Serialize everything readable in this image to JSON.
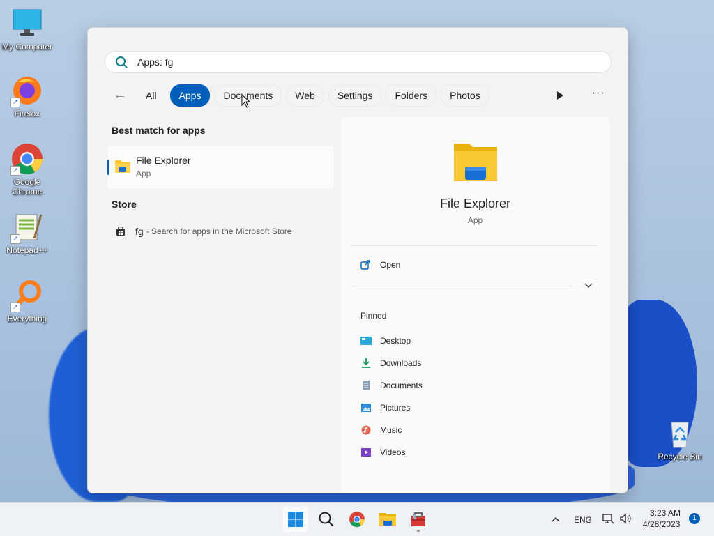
{
  "desktop": {
    "icons": [
      {
        "label": "My Computer"
      },
      {
        "label": "Firefox"
      },
      {
        "label": "Google Chrome"
      },
      {
        "label": "Notepad++"
      },
      {
        "label": "Everything"
      },
      {
        "label": "Recycle Bin"
      }
    ]
  },
  "search": {
    "value": "Apps: fg"
  },
  "filters": [
    {
      "label": "All"
    },
    {
      "label": "Apps"
    },
    {
      "label": "Documents"
    },
    {
      "label": "Web"
    },
    {
      "label": "Settings"
    },
    {
      "label": "Folders"
    },
    {
      "label": "Photos"
    }
  ],
  "left": {
    "best_match_title": "Best match for apps",
    "best_match": {
      "name": "File Explorer",
      "kind": "App"
    },
    "store_title": "Store",
    "store_query": "fg",
    "store_sub": "- Search for apps in the Microsoft Store"
  },
  "right": {
    "title": "File Explorer",
    "kind": "App",
    "open_label": "Open",
    "pinned_title": "Pinned",
    "pinned": [
      {
        "label": "Desktop"
      },
      {
        "label": "Downloads"
      },
      {
        "label": "Documents"
      },
      {
        "label": "Pictures"
      },
      {
        "label": "Music"
      },
      {
        "label": "Videos"
      }
    ]
  },
  "taskbar": {
    "lang": "ENG",
    "time": "3:23 AM",
    "date": "4/28/2023",
    "notification_count": "1"
  },
  "colors": {
    "accent": "#005fb8",
    "folder_yellow": "#f8c935"
  }
}
